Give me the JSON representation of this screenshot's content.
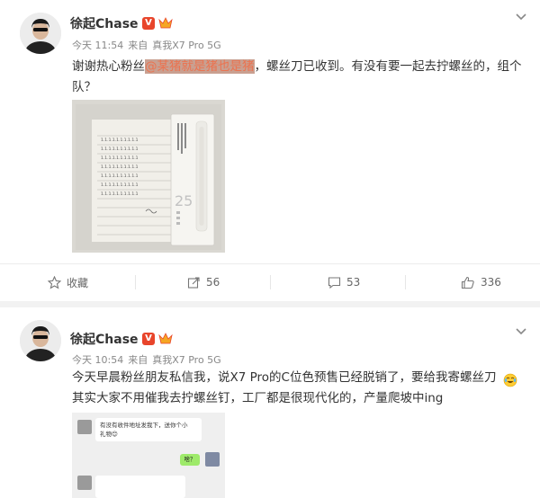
{
  "posts": [
    {
      "username": "徐起Chase",
      "verified_badge": "V",
      "time": "今天 11:54",
      "source_prefix": "来自",
      "device": "真我X7 Pro 5G",
      "body_before": "谢谢热心粉丝",
      "mention": "@某猪就是猪也是猪",
      "body_after": "，螺丝刀已收到。有没有要一起去拧螺丝的，组个队？",
      "image_text": {
        "number": "25",
        "letter_lines": [
          "1.1.1.1.1.1.1.1.1.1",
          "1.1.1.1.1.1.1.1.1.1",
          "1.1.1.1.1.1.1.1.1.1",
          "1.1.1.1.1.1.1.1.1.1",
          "1.1.1.1.1.1.1.1.1.1",
          "1.1.1.1.1.1.1.1.1.1",
          "1.1.1.1.1.1.1.1.1.1"
        ]
      },
      "actions": {
        "favorite": "收藏",
        "repost": "56",
        "comment": "53",
        "like": "336"
      }
    },
    {
      "username": "徐起Chase",
      "verified_badge": "V",
      "time": "今天 10:54",
      "source_prefix": "来自",
      "device": "真我X7 Pro 5G",
      "body_line1": "今天早晨粉丝朋友私信我，说X7 Pro的C位色预售已经脱销了，要给我寄螺丝刀",
      "body_line2": "其实大家不用催我去拧螺丝钉，工厂都是很现代化的，产量爬坡中ing",
      "chat": {
        "msg1_line1": "有没有收件地址发我下，送你个小",
        "msg1_line2": "礼物😊",
        "msg2": "啥？"
      }
    }
  ],
  "colors": {
    "badge": "#e8452b",
    "mention": "#eb7350",
    "reply_bubble": "#9eea6a"
  }
}
